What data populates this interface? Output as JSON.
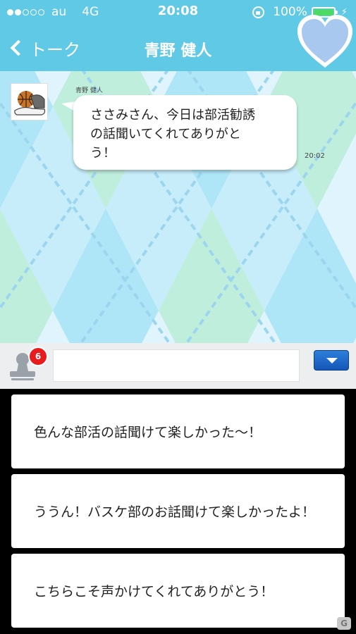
{
  "status_bar": {
    "carrier": "au",
    "network": "4G",
    "time": "20:08",
    "battery": "100%"
  },
  "nav": {
    "back_label": "トーク",
    "title": "青野 健人"
  },
  "chat": {
    "sender_name": "青野 健人",
    "message_line1": "ささみさん、今日は部活勧誘",
    "message_line2": "の話聞いてくれてありがと",
    "message_line3": "う！",
    "time": "20:02"
  },
  "input": {
    "badge_count": "6",
    "placeholder": ""
  },
  "choices": [
    {
      "label": "色んな部活の話聞けて楽しかった〜！"
    },
    {
      "label": "ううん！バスケ部のお話聞けて楽しかったよ！"
    },
    {
      "label": "こちらこそ声かけてくれてありがとう！"
    }
  ],
  "colors": {
    "header": "#5fc9e6",
    "argyle_blue": "#aee6f8",
    "argyle_mint": "#bfeedd",
    "argyle_light": "#dff4fd",
    "heart": "#a8c8f0",
    "badge": "#e81c1c"
  },
  "icons": {
    "back": "chevron-left-icon",
    "heart": "heart-icon",
    "stamp": "stamp-icon",
    "dropdown": "triangle-down-icon"
  }
}
